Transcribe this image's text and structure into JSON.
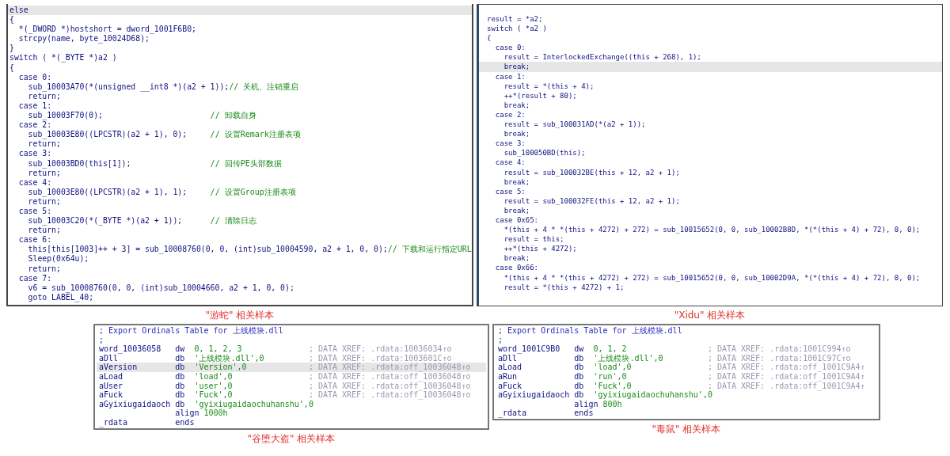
{
  "top_panels": [
    {
      "lines": [
        {
          "code": "else",
          "highlighted": true
        },
        {
          "code": "{",
          "highlighted": false
        },
        {
          "code": "  *(_DWORD *)hostshort = dword_1001F6B0;",
          "highlighted": false
        },
        {
          "code": "  strcpy(name, byte_10024D68);",
          "highlighted": false
        },
        {
          "code": "}",
          "highlighted": false
        },
        {
          "code": "switch ( *(_BYTE *)a2 )",
          "highlighted": false
        },
        {
          "code": "{",
          "highlighted": false
        },
        {
          "code": "  case 0:",
          "highlighted": false
        },
        {
          "code": "    sub_10003A70(*(unsigned __int8 *)(a2 + 1));",
          "comment": "// 关机、注销重启",
          "highlighted": false
        },
        {
          "code": "    return;",
          "highlighted": false
        },
        {
          "code": "  case 1:",
          "highlighted": false
        },
        {
          "code": "    sub_10003F70(0);",
          "comment": "// 卸载自身",
          "highlighted": false
        },
        {
          "code": "  case 2:",
          "highlighted": false
        },
        {
          "code": "    sub_10003E80((LPCSTR)(a2 + 1), 0);",
          "comment": "// 设置Remark注册表项",
          "highlighted": false
        },
        {
          "code": "    return;",
          "highlighted": false
        },
        {
          "code": "  case 3:",
          "highlighted": false
        },
        {
          "code": "    sub_10003BD0(this[1]);",
          "comment": "// 回传PE头部数据",
          "highlighted": false
        },
        {
          "code": "    return;",
          "highlighted": false
        },
        {
          "code": "  case 4:",
          "highlighted": false
        },
        {
          "code": "    sub_10003E80((LPCSTR)(a2 + 1), 1);",
          "comment": "// 设置Group注册表项",
          "highlighted": false
        },
        {
          "code": "    return;",
          "highlighted": false
        },
        {
          "code": "  case 5:",
          "highlighted": false
        },
        {
          "code": "    sub_10003C20(*(_BYTE *)(a2 + 1));",
          "comment": "// 清除日志",
          "highlighted": false
        },
        {
          "code": "    return;",
          "highlighted": false
        },
        {
          "code": "  case 6:",
          "highlighted": false
        },
        {
          "code": "    this[this[1003]++ + 3] = sub_10008760(0, 0, (int)sub_10004590, a2 + 1, 0, 0);",
          "comment": "// 下载和运行指定URL",
          "highlighted": false
        },
        {
          "code": "    Sleep(0x64u);",
          "highlighted": false
        },
        {
          "code": "    return;",
          "highlighted": false
        },
        {
          "code": "  case 7:",
          "highlighted": false
        },
        {
          "code": "    v6 = sub_10008760(0, 0, (int)sub_10004660, a2 + 1, 0, 0);",
          "highlighted": false
        },
        {
          "code": "    goto LABEL_40;",
          "highlighted": false
        }
      ],
      "caption": "\"游蛇\" 相关样本"
    },
    {
      "lines": [
        {
          "code": "result = *a2;",
          "highlighted": false
        },
        {
          "code": "switch ( *a2 )",
          "highlighted": false
        },
        {
          "code": "{",
          "highlighted": false
        },
        {
          "code": "  case 0:",
          "highlighted": false
        },
        {
          "code": "    result = InterlockedExchange((this + 268), 1);",
          "highlighted": false
        },
        {
          "code": "    break;",
          "highlighted": true
        },
        {
          "code": "  case 1:",
          "highlighted": false
        },
        {
          "code": "    result = *(this + 4);",
          "highlighted": false
        },
        {
          "code": "    ++*(result + 80);",
          "highlighted": false
        },
        {
          "code": "    break;",
          "highlighted": false
        },
        {
          "code": "  case 2:",
          "highlighted": false
        },
        {
          "code": "    result = sub_100031AD(*(a2 + 1));",
          "highlighted": false
        },
        {
          "code": "    break;",
          "highlighted": false
        },
        {
          "code": "  case 3:",
          "highlighted": false
        },
        {
          "code": "    sub_100050BD(this);",
          "highlighted": false
        },
        {
          "code": "  case 4:",
          "highlighted": false
        },
        {
          "code": "    result = sub_100032BE(this + 12, a2 + 1);",
          "highlighted": false
        },
        {
          "code": "    break;",
          "highlighted": false
        },
        {
          "code": "  case 5:",
          "highlighted": false
        },
        {
          "code": "    result = sub_100032FE(this + 12, a2 + 1);",
          "highlighted": false
        },
        {
          "code": "    break;",
          "highlighted": false
        },
        {
          "code": "  case 0x65:",
          "highlighted": false
        },
        {
          "code": "    *(this + 4 * *(this + 4272) + 272) = sub_10015652(0, 0, sub_10002B8D, *(*(this + 4) + 72), 0, 0);",
          "highlighted": false
        },
        {
          "code": "    result = this;",
          "highlighted": false
        },
        {
          "code": "    ++*(this + 4272);",
          "highlighted": false
        },
        {
          "code": "    break;",
          "highlighted": false
        },
        {
          "code": "  case 0x66:",
          "highlighted": false
        },
        {
          "code": "    *(this + 4 * *(this + 4272) + 272) = sub_10015652(0, 0, sub_10002D9A, *(*(this + 4) + 72), 0, 0);",
          "highlighted": false
        },
        {
          "code": "    result = *(this + 4272) + 1;",
          "highlighted": false
        }
      ],
      "caption": "\"Xidu\" 相关样本"
    }
  ],
  "bottom_panels": [
    {
      "rows": [
        {
          "kind": "comment",
          "text": "; Export Ordinals Table for 上线模块.dll",
          "highlighted": false
        },
        {
          "kind": "comment",
          "text": ";",
          "highlighted": false
        },
        {
          "kind": "entry",
          "label": "word_10036058",
          "op": "dw",
          "operand": "0, 1, 2, 3",
          "xref": "; DATA XREF: .rdata:10036034↑o",
          "highlighted": false
        },
        {
          "kind": "entry",
          "label": "aDll",
          "op": "db",
          "operand": "'上线模块.dll',0",
          "xref": "; DATA XREF: .rdata:1003601C↑o",
          "highlighted": false
        },
        {
          "kind": "entry",
          "label": "aVersion",
          "op": "db",
          "operand": "'Version',0",
          "xref": "; DATA XREF: .rdata:off_10036048↑o",
          "highlighted": true
        },
        {
          "kind": "entry",
          "label": "aLoad",
          "op": "db",
          "operand": "'load',0",
          "xref": "; DATA XREF: .rdata:off_10036048↑o",
          "highlighted": false
        },
        {
          "kind": "entry",
          "label": "aUser",
          "op": "db",
          "operand": "'user',0",
          "xref": "; DATA XREF: .rdata:off_10036048↑o",
          "highlighted": false
        },
        {
          "kind": "entry",
          "label": "aFuck",
          "op": "db",
          "operand": "'Fuck',0",
          "xref": "; DATA XREF: .rdata:off_10036048↑o",
          "highlighted": false
        },
        {
          "kind": "entry",
          "label": "aGyixiugaidaoch",
          "op": "db",
          "operand": "'gyixiugaidaochuhanshu',0",
          "highlighted": false
        },
        {
          "kind": "entry",
          "op": "align",
          "operand": "1000h",
          "highlighted": false
        },
        {
          "kind": "entry",
          "label": "_rdata",
          "op": "ends",
          "highlighted": false
        }
      ],
      "caption": "\"谷堕大盗\" 相关样本"
    },
    {
      "rows": [
        {
          "kind": "comment",
          "text": "; Export Ordinals Table for 上线模块.dll",
          "highlighted": false
        },
        {
          "kind": "comment",
          "text": ";",
          "highlighted": false
        },
        {
          "kind": "entry",
          "label": "word_1001C9B0",
          "op": "dw",
          "operand": "0, 1, 2",
          "xref": "; DATA XREF: .rdata:1001C994↑o",
          "highlighted": false
        },
        {
          "kind": "entry",
          "label": "aDll",
          "op": "db",
          "operand": "'上线模块.dll',0",
          "xref": "; DATA XREF: .rdata:1001C97C↑o",
          "highlighted": false
        },
        {
          "kind": "entry",
          "label": "aLoad",
          "op": "db",
          "operand": "'load',0",
          "xref": "; DATA XREF: .rdata:off_1001C9A4↑",
          "highlighted": false
        },
        {
          "kind": "entry",
          "label": "aRun",
          "op": "db",
          "operand": "'run',0",
          "xref": "; DATA XREF: .rdata:off_1001C9A4↑",
          "highlighted": false
        },
        {
          "kind": "entry",
          "label": "aFuck",
          "op": "db",
          "operand": "'Fuck',0",
          "xref": "; DATA XREF: .rdata:off_1001C9A4↑",
          "highlighted": false
        },
        {
          "kind": "entry",
          "label": "aGyixiugaidaoch",
          "op": "db",
          "operand": "'gyixiugaidaochuhanshu',0",
          "highlighted": false
        },
        {
          "kind": "entry",
          "op": "align",
          "operand": "800h",
          "highlighted": false
        },
        {
          "kind": "entry",
          "label": "_rdata",
          "op": "ends",
          "highlighted": false
        }
      ],
      "caption": "\"毒鼠\" 相关样本"
    }
  ]
}
